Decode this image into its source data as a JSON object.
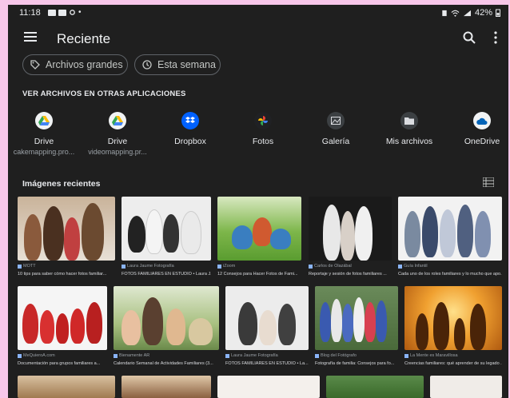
{
  "status_bar": {
    "time": "11:18",
    "battery": "42%"
  },
  "header": {
    "title": "Reciente"
  },
  "chips": [
    {
      "label": "Archivos grandes",
      "icon": "tag-icon"
    },
    {
      "label": "Esta semana",
      "icon": "history-icon"
    }
  ],
  "other_apps": {
    "heading": "VER ARCHIVOS EN OTRAS APLICACIONES",
    "apps": [
      {
        "label": "Drive",
        "sub": "cakemapping.pro...",
        "icon": "google-drive-icon"
      },
      {
        "label": "Drive",
        "sub": "videomapping.pr...",
        "icon": "google-drive-icon"
      },
      {
        "label": "Dropbox",
        "sub": "",
        "icon": "dropbox-icon"
      },
      {
        "label": "Fotos",
        "sub": "",
        "icon": "google-photos-icon"
      },
      {
        "label": "Galería",
        "sub": "",
        "icon": "gallery-icon"
      },
      {
        "label": "Mis archivos",
        "sub": "",
        "icon": "folder-icon"
      },
      {
        "label": "OneDrive",
        "sub": "",
        "icon": "onedrive-icon"
      }
    ]
  },
  "recent_images": {
    "heading": "Imágenes recientes",
    "rows": [
      [
        {
          "source": "MOTT",
          "caption": "10 tips para saber cómo hacer fotos familiar..."
        },
        {
          "source": "Laura Jaume Fotografía",
          "caption": "FOTOS FAMILIARES EN ESTUDIO • Laura J..."
        },
        {
          "source": "iZoom",
          "caption": "12 Consejos para Hacer Fotos de Fami..."
        },
        {
          "source": "Carlos de Olazábal",
          "caption": "Reportaje y sesión de fotos familiares ..."
        },
        {
          "source": "Guía Infantil",
          "caption": "Cada uno de los roles familiares y lo mucho que apo..."
        }
      ],
      [
        {
          "source": "MeQuieroA.com",
          "caption": "Documentación para grupos familiares a..."
        },
        {
          "source": "Bienamente AR",
          "caption": "Calendario Semanal de Actividades Familiares (3..."
        },
        {
          "source": "Laura Jaume Fotografía",
          "caption": "FOTOS FAMILIARES EN ESTUDIO • La..."
        },
        {
          "source": "Blog del Fotógrafo",
          "caption": "Fotografía de familia: Consejos para fo..."
        },
        {
          "source": "La Mente es Maravillosa",
          "caption": "Creencias familiares: qué aprender de su legado ..."
        }
      ]
    ]
  },
  "colors": {
    "background": "#1f1f1f",
    "text": "#e8eaed",
    "frame": "#f7c6e9"
  }
}
